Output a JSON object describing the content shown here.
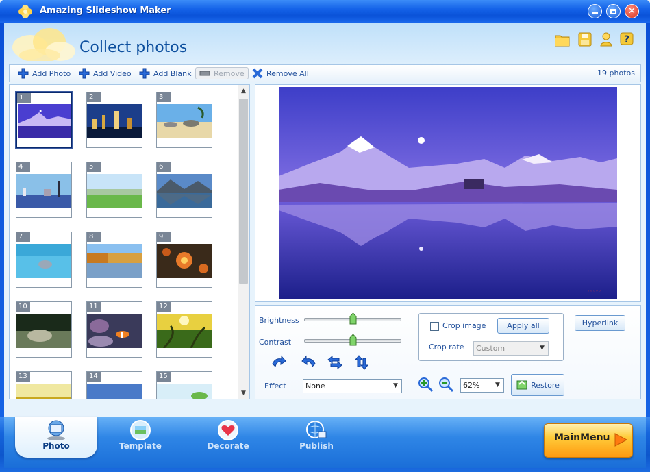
{
  "window": {
    "title": "Amazing Slideshow Maker",
    "minimize_icon": "minimize-icon",
    "maximize_icon": "maximize-icon",
    "close_icon": "close-icon"
  },
  "header": {
    "title": "Collect photos",
    "icons": [
      "folder-icon",
      "save-icon",
      "user-icon",
      "help-icon"
    ]
  },
  "toolbar": {
    "add_photo": "Add Photo",
    "add_video": "Add Video",
    "add_blank": "Add Blank",
    "remove": "Remove",
    "remove_all": "Remove All",
    "photo_count": "19 photos"
  },
  "thumbnails": [
    {
      "num": "1",
      "scene": "purple-mountain-lake"
    },
    {
      "num": "2",
      "scene": "city-night"
    },
    {
      "num": "3",
      "scene": "rocky-beach"
    },
    {
      "num": "4",
      "scene": "waterfront-city"
    },
    {
      "num": "5",
      "scene": "green-meadow"
    },
    {
      "num": "6",
      "scene": "mountain-lake-reflection"
    },
    {
      "num": "7",
      "scene": "dolphin"
    },
    {
      "num": "8",
      "scene": "autumn-trees-lake"
    },
    {
      "num": "9",
      "scene": "coral"
    },
    {
      "num": "10",
      "scene": "stingray"
    },
    {
      "num": "11",
      "scene": "clownfish-reef"
    },
    {
      "num": "12",
      "scene": "sunlit-tree"
    },
    {
      "num": "13",
      "scene": "sunset-road"
    },
    {
      "num": "14",
      "scene": "sky"
    },
    {
      "num": "15",
      "scene": "green-leaves"
    }
  ],
  "controls": {
    "brightness_label": "Brightness",
    "brightness_value": 0.5,
    "contrast_label": "Contrast",
    "contrast_value": 0.5,
    "rotate_icons": [
      "rotate-left-icon",
      "rotate-right-icon",
      "flip-horizontal-icon",
      "flip-vertical-icon"
    ],
    "effect_label": "Effect",
    "effect_value": "None",
    "crop_image_label": "Crop image",
    "crop_image_checked": false,
    "apply_all": "Apply all",
    "crop_rate_label": "Crop rate",
    "crop_rate_value": "Custom",
    "hyperlink": "Hyperlink",
    "zoom_value": "62%",
    "restore": "Restore"
  },
  "bottom_nav": {
    "tabs": [
      {
        "label": "Photo",
        "icon": "photo-icon",
        "active": true
      },
      {
        "label": "Template",
        "icon": "template-icon",
        "active": false
      },
      {
        "label": "Decorate",
        "icon": "decorate-icon",
        "active": false
      },
      {
        "label": "Publish",
        "icon": "publish-icon",
        "active": false
      }
    ],
    "main_menu": "MainMenu"
  }
}
